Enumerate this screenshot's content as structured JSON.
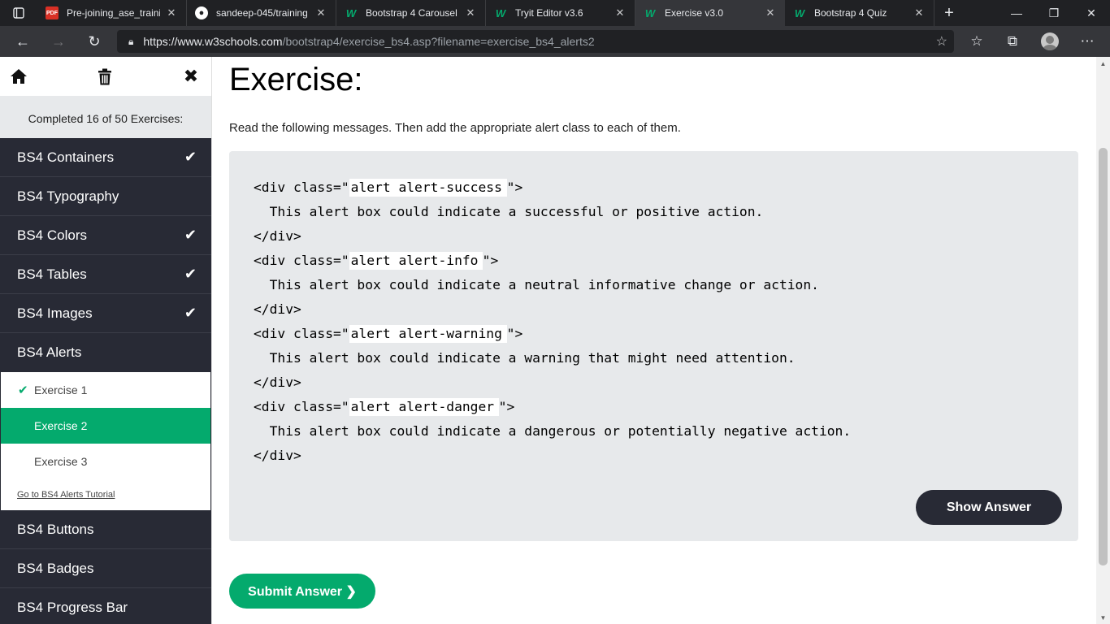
{
  "browser": {
    "tabs": [
      {
        "title": "Pre-joining_ase_training",
        "icon": "pdf-icon"
      },
      {
        "title": "sandeep-045/training",
        "icon": "github-icon"
      },
      {
        "title": "Bootstrap 4 Carousel",
        "icon": "w3schools-icon"
      },
      {
        "title": "Tryit Editor v3.6",
        "icon": "w3schools-icon"
      },
      {
        "title": "Exercise v3.0",
        "icon": "w3schools-icon",
        "active": true
      },
      {
        "title": "Bootstrap 4 Quiz",
        "icon": "w3schools-icon"
      }
    ],
    "url_host": "https://www.w3schools.com",
    "url_path": "/bootstrap4/exercise_bs4.asp?filename=exercise_bs4_alerts2"
  },
  "sidebar": {
    "progress": "Completed 16 of 50 Exercises:",
    "categories_top": [
      {
        "label": "BS4 Containers",
        "done": true
      },
      {
        "label": "BS4 Typography",
        "done": false
      },
      {
        "label": "BS4 Colors",
        "done": true
      },
      {
        "label": "BS4 Tables",
        "done": true
      },
      {
        "label": "BS4 Images",
        "done": true
      },
      {
        "label": "BS4 Alerts",
        "done": false
      }
    ],
    "exercises": [
      {
        "label": "Exercise 1",
        "done": true,
        "active": false
      },
      {
        "label": "Exercise 2",
        "done": false,
        "active": true
      },
      {
        "label": "Exercise 3",
        "done": false,
        "active": false
      }
    ],
    "tutorial_link": "Go to BS4 Alerts Tutorial",
    "categories_bottom": [
      {
        "label": "BS4 Buttons"
      },
      {
        "label": "BS4 Badges"
      },
      {
        "label": "BS4 Progress Bar"
      }
    ]
  },
  "exercise": {
    "title": "Exercise:",
    "instruction": "Read the following messages. Then add the appropriate alert class to each of them.",
    "blocks": [
      {
        "open_prefix": "<div class=\"",
        "value": "alert alert-success",
        "open_suffix": "\">",
        "text": "  This alert box could indicate a successful or positive action.",
        "close": "</div>"
      },
      {
        "open_prefix": "<div class=\"",
        "value": "alert alert-info",
        "open_suffix": "\">",
        "text": "  This alert box could indicate a neutral informative change or action.",
        "close": "</div>"
      },
      {
        "open_prefix": "<div class=\"",
        "value": "alert alert-warning",
        "open_suffix": "\">",
        "text": "  This alert box could indicate a warning that might need attention.",
        "close": "</div>"
      },
      {
        "open_prefix": "<div class=\"",
        "value": "alert alert-danger",
        "open_suffix": "\">",
        "text": "  This alert box could indicate a dangerous or potentially negative action.",
        "close": "</div>"
      }
    ],
    "show_answer_label": "Show Answer",
    "submit_label": "Submit Answer ❯"
  },
  "colors": {
    "accent": "#04aa6d",
    "dark": "#282a35",
    "code_bg": "#e7e9eb"
  }
}
